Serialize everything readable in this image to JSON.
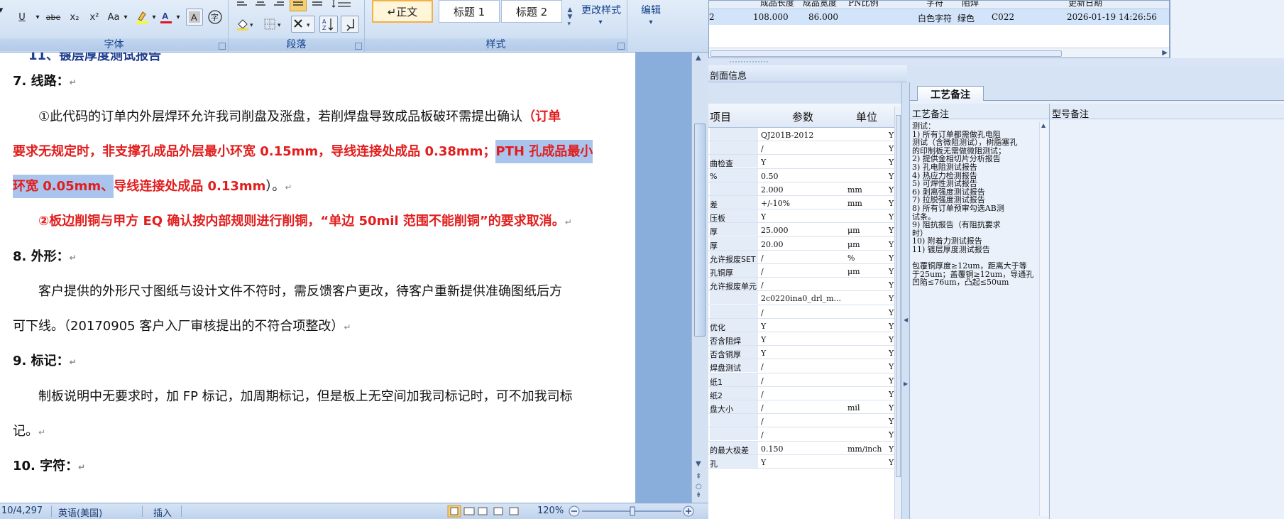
{
  "word": {
    "ribbon": {
      "font_group_label": "字体",
      "paragraph_group_label": "段落",
      "styles_group_label": "样式",
      "font_buttons": [
        "U",
        "abe",
        "x₂",
        "x²",
        "Aa"
      ],
      "styles": [
        "↵正文",
        "标题 1",
        "标题 2"
      ],
      "change_styles_label": "更改样式",
      "edit_label": "编辑"
    },
    "document": {
      "top_cut_line": "11、镀层厚度测试报告",
      "heading_7": "7. 线路：",
      "p7_1_start": "①此代码的订单内外层焊环允许我司削盘及涨盘，若削焊盘导致成品板破环需提出确认",
      "p7_1_red_a": "（订单",
      "p7_2_red": "要求无规定时，非支撑孔成品外层最小环宽 0.15mm，导线连接处成品 0.38mm；",
      "p7_2_sel": "PTH 孔成品最小",
      "p7_3_sel": "环宽 0.05mm、",
      "p7_3_red": "导线连接处成品 0.13mm",
      "p7_3_end": "）。",
      "p7_4_red": "②板边削铜与甲方 EQ 确认按内部规则进行削铜，“单边 50mil 范围不能削铜”的要求取消。",
      "heading_8": "8. 外形：",
      "p8_1": "客户提供的外形尺寸图纸与设计文件不符时，需反馈客户更改，待客户重新提供准确图纸后方",
      "p8_2": "可下线。（20170905 客户入厂审核提出的不符合项整改）",
      "heading_9": "9. 标记：",
      "p9_1": "制板说明中无要求时，加 FP 标记，加周期标记，但是板上无空间加我司标记时，可不加我司标",
      "p9_2": "记。",
      "heading_10": "10. 字符：",
      "para_mark": "↵"
    },
    "status": {
      "page": "10/4,297",
      "language": "英语(美国)",
      "mode": "插入",
      "zoom": "120%"
    }
  },
  "app": {
    "top_grid": {
      "headers": [
        "成品长度",
        "成品宽度",
        "PN比例",
        "字符",
        "阻焊",
        "更新日期"
      ],
      "row": {
        "col0": "2",
        "length": "108.000",
        "width": "86.000",
        "char": "白色字符",
        "mask": "绿色",
        "code": "C022",
        "date": "2026-01-19 14:26:56"
      }
    },
    "section_title": "剖面信息",
    "param_grid": {
      "headers": {
        "item": "项目",
        "param": "参数",
        "unit": "单位"
      },
      "rows": [
        {
          "name": "",
          "val": "QJ201B-2012",
          "unit": "",
          "y": "Y"
        },
        {
          "name": "",
          "val": "/",
          "unit": "",
          "y": "Y"
        },
        {
          "name": "曲检查",
          "val": "Y",
          "unit": "",
          "y": "Y"
        },
        {
          "name": "%",
          "val": "0.50",
          "unit": "",
          "y": "Y"
        },
        {
          "name": "",
          "val": "2.000",
          "unit": "mm",
          "y": "Y"
        },
        {
          "name": "差",
          "val": "+/-10%",
          "unit": "mm",
          "y": "Y"
        },
        {
          "name": "压板",
          "val": "Y",
          "unit": "",
          "y": "Y"
        },
        {
          "name": "厚",
          "val": "25.000",
          "unit": "μm",
          "y": "Y"
        },
        {
          "name": "厚",
          "val": "20.00",
          "unit": "μm",
          "y": "Y"
        },
        {
          "name": "允许报废SET",
          "val": "/",
          "unit": "%",
          "y": "Y"
        },
        {
          "name": "孔铜厚",
          "val": "/",
          "unit": "μm",
          "y": "Y"
        },
        {
          "name": "允许报废单元",
          "val": "/",
          "unit": "",
          "y": "Y"
        },
        {
          "name": "",
          "val": "2c0220ina0_drl_m...",
          "unit": "",
          "y": "Y"
        },
        {
          "name": "",
          "val": "/",
          "unit": "",
          "y": "Y"
        },
        {
          "name": "优化",
          "val": "Y",
          "unit": "",
          "y": "Y"
        },
        {
          "name": "否含阻焊",
          "val": "Y",
          "unit": "",
          "y": "Y"
        },
        {
          "name": "否含铜厚",
          "val": "Y",
          "unit": "",
          "y": "Y"
        },
        {
          "name": "焊盘测试",
          "val": "/",
          "unit": "",
          "y": "Y"
        },
        {
          "name": "纸1",
          "val": "/",
          "unit": "",
          "y": "Y"
        },
        {
          "name": "纸2",
          "val": "/",
          "unit": "",
          "y": "Y"
        },
        {
          "name": "盘大小",
          "val": "/",
          "unit": "mil",
          "y": "Y"
        },
        {
          "name": "",
          "val": "/",
          "unit": "",
          "y": "Y"
        },
        {
          "name": "",
          "val": "/",
          "unit": "",
          "y": "Y"
        },
        {
          "name": "的最大极差",
          "val": "0.150",
          "unit": "mm/inch",
          "y": "Y"
        },
        {
          "name": "孔",
          "val": "Y",
          "unit": "",
          "y": "Y"
        }
      ]
    },
    "notes": {
      "tab_label": "工艺备注",
      "col_process": "工艺备注",
      "col_model": "型号备注",
      "lines": [
        "测试：",
        "1)      所有订单都需做孔电阻",
        "测试（含微阻测试），树脂塞孔",
        "的印制板无需做微阻测试；",
        "2)      提供金相切片分析报告",
        "3)      孔电阻测试报告",
        "4)      热应力检测报告",
        "5)      可焊性测试报告",
        "6)      剥离强度测试报告",
        "7)      拉脱强度测试报告",
        "8)      所有订单预审勾选AB测",
        "试条。",
        "9)      阻抗报告（有阻抗要求",
        "时）",
        "10)     附着力测试报告",
        "11)     镀层厚度测试报告",
        "",
        "包覆铜厚度≥12um，距离大于等",
        "于25um；盖覆铜≥12um，导通孔",
        "凹陷≤76um，凸起≤50um"
      ]
    }
  }
}
